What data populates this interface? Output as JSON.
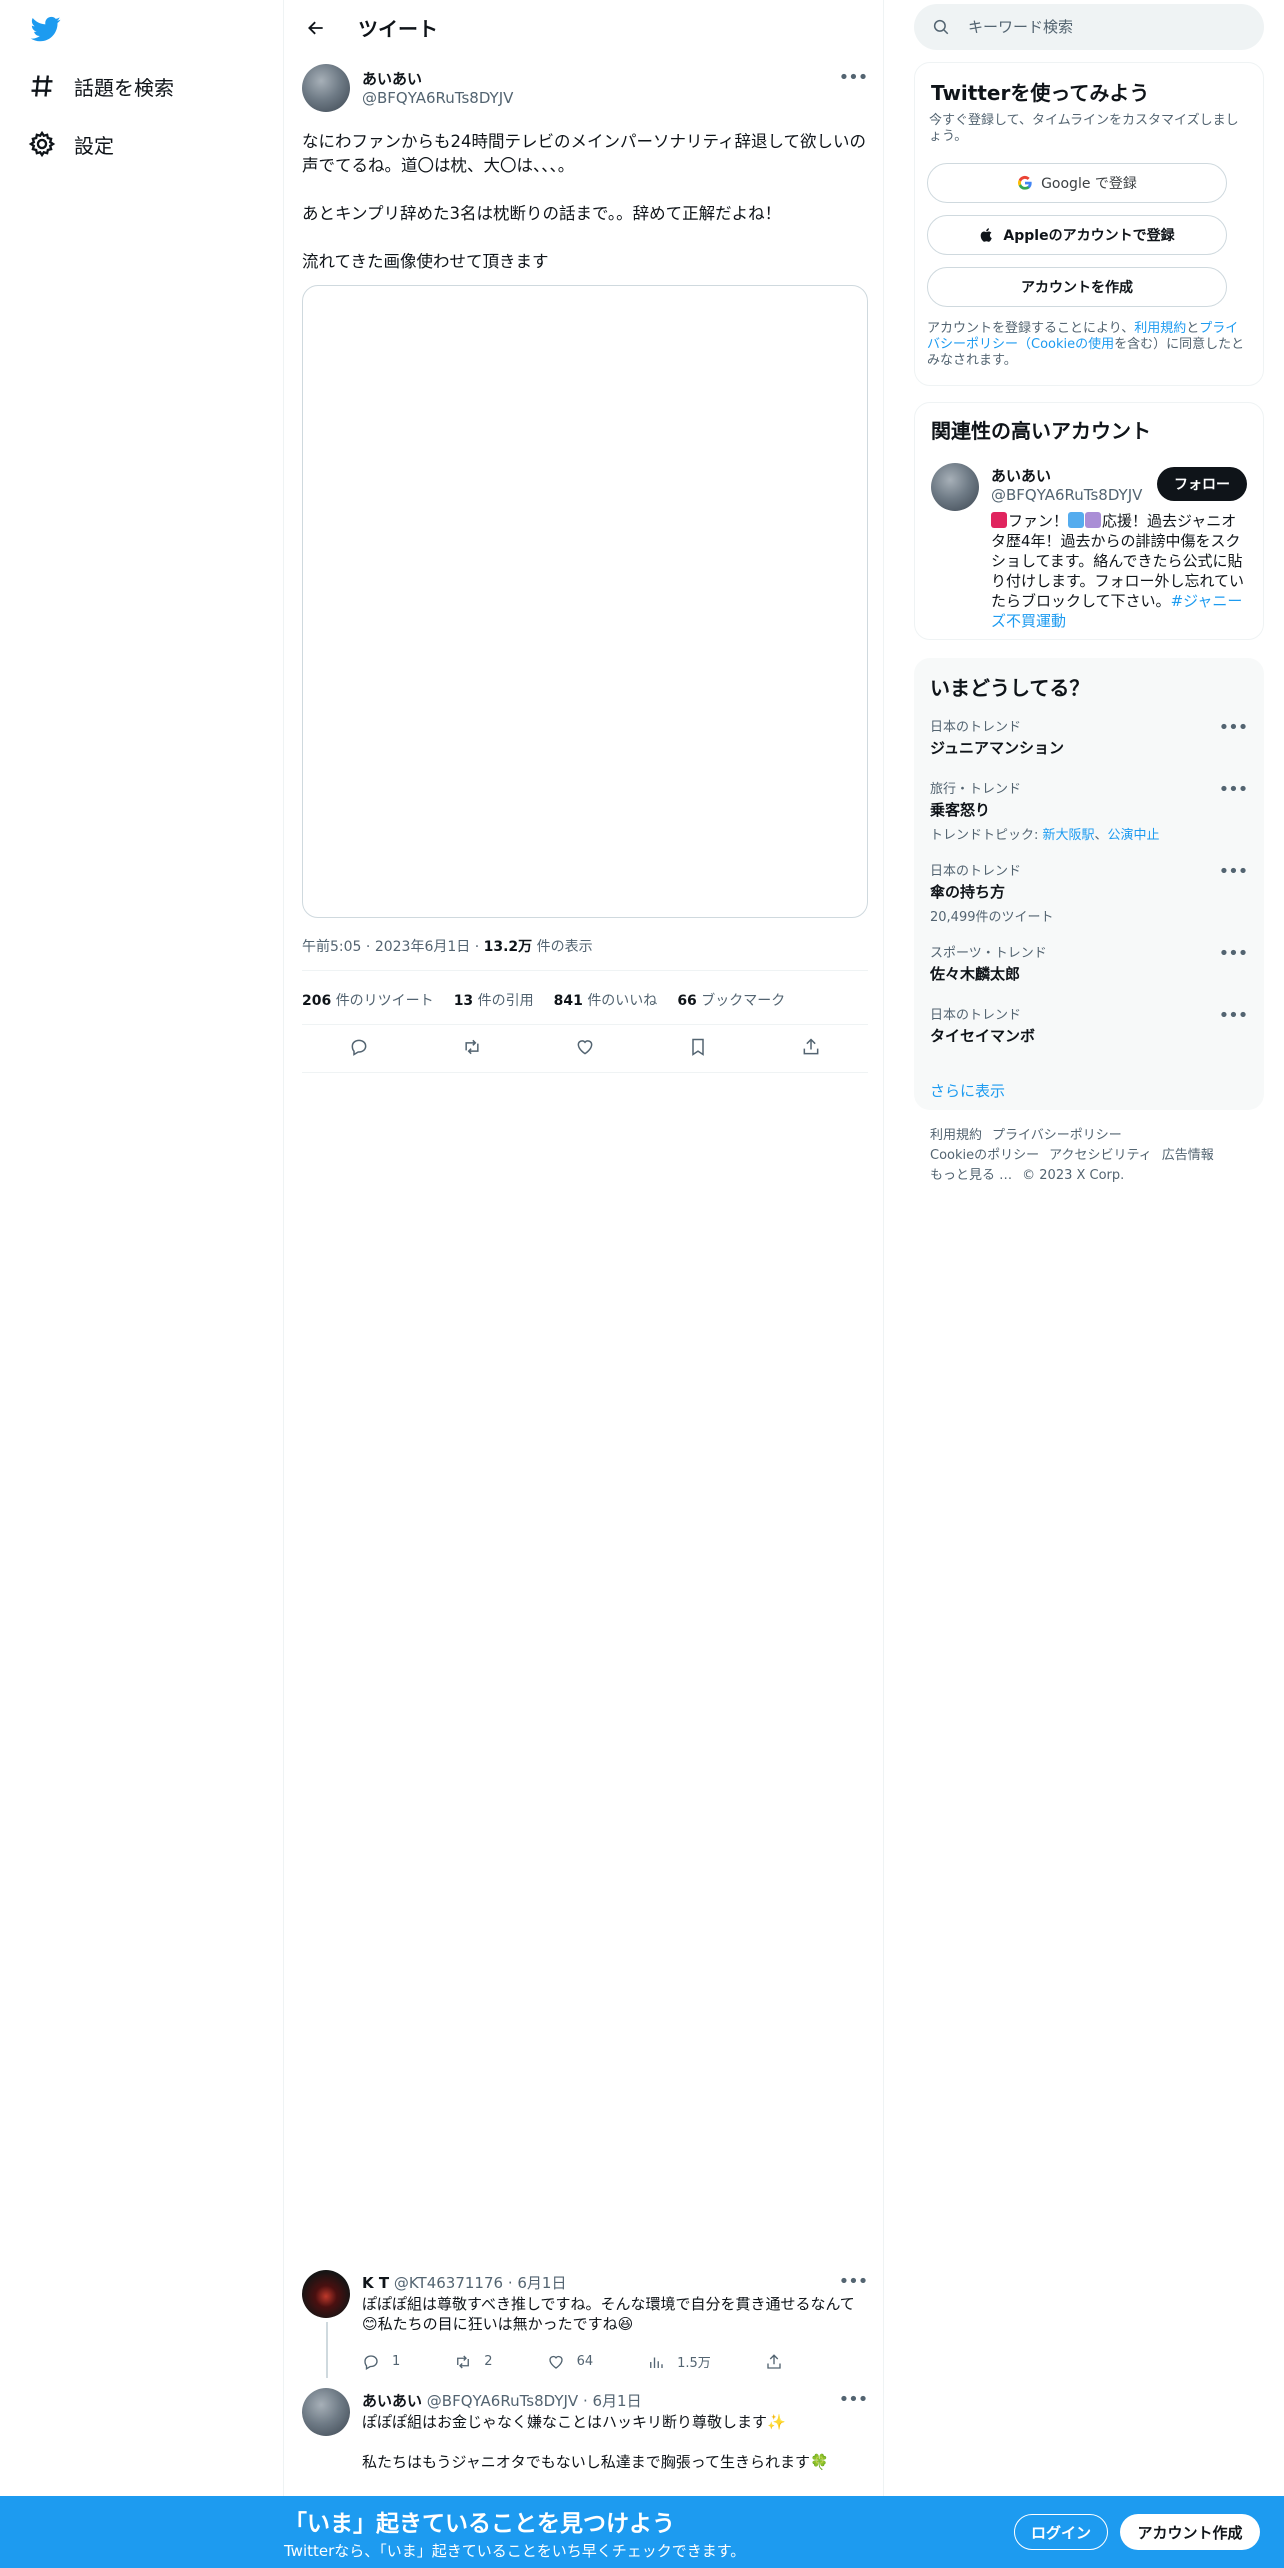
{
  "nav": {
    "logo_icon": "twitter-bird-icon",
    "explore_label": "話題を検索",
    "settings_label": "設定"
  },
  "header": {
    "title": "ツイート",
    "back_icon": "arrow-left-icon"
  },
  "tweet": {
    "author_name": "あいあい",
    "author_handle": "@BFQYA6RuTs8DYJV",
    "paragraphs": [
      "なにわファンからも24時間テレビのメインパーソナリティ辞退して欲しいの声でてるね。道〇は枕、大〇は、、、。",
      "あとキンプリ辞めた3名は枕断りの話まで。。辞めて正解だよね！",
      "流れてきた画像使わせて頂きます"
    ],
    "time": "午前5:05",
    "date": "2023年6月1日",
    "views_count": "13.2万",
    "views_label": "件の表示",
    "retweets_count": "206",
    "retweets_label": "件のリツイート",
    "quotes_count": "13",
    "quotes_label": "件の引用",
    "likes_count": "841",
    "likes_label": "件のいいね",
    "bookmarks_count": "66",
    "bookmarks_label": "ブックマーク"
  },
  "replies": [
    {
      "name": "K T",
      "handle": "@KT46371176",
      "date": "6月1日",
      "text": "ぽぽぽ組は尊敬すべき推しですね。そんな環境で自分を貫き通せるなんて😊私たちの目に狂いは無かったですね😆",
      "replies_count": "1",
      "retweets_count": "2",
      "likes_count": "64",
      "views_count": "1.5万"
    },
    {
      "name": "あいあい",
      "handle": "@BFQYA6RuTs8DYJV",
      "date": "6月1日",
      "text1": "ぽぽぽ組はお金じゃなく嫌なことはハッキリ断り尊敬します✨",
      "text2": "私たちはもうジャニオタでもないし私達まで胸張って生きられます🍀"
    }
  ],
  "search": {
    "placeholder": "キーワード検索"
  },
  "signup_panel": {
    "title": "Twitterを使ってみよう",
    "subtitle": "今すぐ登録して、タイムラインをカスタマイズしましょう。",
    "google_label": "Google で登録",
    "apple_label": "Appleのアカウントで登録",
    "create_label": "アカウントを作成",
    "legal_prefix": "アカウントを登録することにより、",
    "legal_terms": "利用規約",
    "legal_and": "と",
    "legal_privacy": "プライバシーポリシー（Cookieの使用",
    "legal_suffix": "を含む）に同意したとみなされます。"
  },
  "related_panel": {
    "title": "関連性の高いアカウント",
    "name": "あいあい",
    "handle": "@BFQYA6RuTs8DYJV",
    "follow_label": "フォロー",
    "bio_part1": "ファン！",
    "bio_part2": "応援！過去ジャニオタ歴4年！過去からの誹謗中傷をスクショしてます。絡んできたら公式に貼り付けします。フォロー外し忘れていたらブロックして下さい。",
    "bio_hashtag": "#ジャニーズ不買運動",
    "colors": {
      "red": "#e0245e",
      "blue": "#55acee",
      "purple": "#aa8ed6"
    }
  },
  "trends_panel": {
    "title": "いまどうしてる？",
    "items": [
      {
        "category": "日本のトレンド",
        "name": "ジュニアマンション"
      },
      {
        "category": "旅行・トレンド",
        "name": "乗客怒り",
        "topic_label": "トレンドトピック: ",
        "topic1": "新大阪駅",
        "topic_sep": "、",
        "topic2": "公演中止"
      },
      {
        "category": "日本のトレンド",
        "name": "傘の持ち方",
        "count": "20,499件のツイート"
      },
      {
        "category": "スポーツ・トレンド",
        "name": "佐々木麟太郎"
      },
      {
        "category": "日本のトレンド",
        "name": "タイセイマンボ"
      }
    ],
    "show_more": "さらに表示"
  },
  "footer": {
    "links": [
      "利用規約",
      "プライバシーポリシー",
      "Cookieのポリシー",
      "アクセシビリティ",
      "広告情報",
      "もっと見る …"
    ],
    "copyright": "© 2023 X Corp."
  },
  "banner": {
    "title": "「いま」起きていることを見つけよう",
    "subtitle": "Twitterなら、「いま」起きていることをいち早くチェックできます。",
    "login_label": "ログイン",
    "signup_label": "アカウント作成"
  },
  "colors": {
    "accent": "#1d9bf0",
    "text": "#0f1419",
    "muted": "#536471"
  }
}
